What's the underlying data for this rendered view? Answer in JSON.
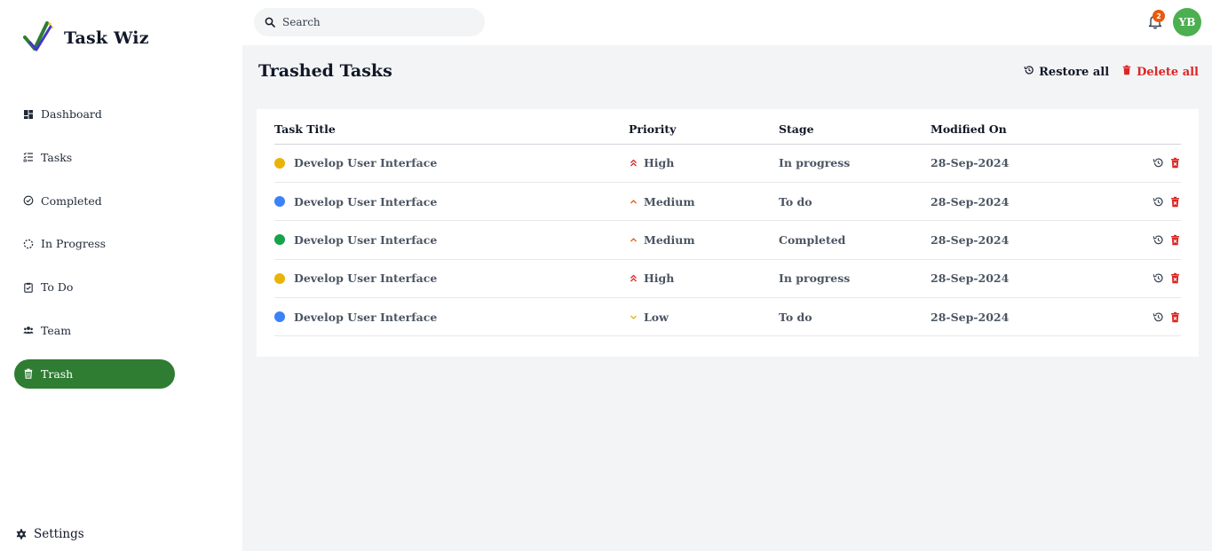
{
  "app": {
    "name": "Task Wiz"
  },
  "sidebar": {
    "items": [
      {
        "label": "Dashboard",
        "icon": "dashboard-icon"
      },
      {
        "label": "Tasks",
        "icon": "checklist-icon"
      },
      {
        "label": "Completed",
        "icon": "check-circle-icon"
      },
      {
        "label": "In Progress",
        "icon": "loader-icon"
      },
      {
        "label": "To Do",
        "icon": "clipboard-check-icon"
      },
      {
        "label": "Team",
        "icon": "users-icon"
      },
      {
        "label": "Trash",
        "icon": "trash-icon",
        "active": true
      }
    ],
    "settings_label": "Settings"
  },
  "topbar": {
    "search_placeholder": "Search",
    "notification_count": "2",
    "avatar_initials": "YB"
  },
  "main": {
    "title": "Trashed Tasks",
    "restore_all_label": "Restore all",
    "delete_all_label": "Delete all",
    "table": {
      "headers": [
        "Task Title",
        "Priority",
        "Stage",
        "Modified On"
      ],
      "rows": [
        {
          "title": "Develop User Interface",
          "dot_color": "#eab308",
          "priority": "High",
          "priority_icon": "double-chevron-up-icon",
          "stage": "In progress",
          "modified": "28-Sep-2024"
        },
        {
          "title": "Develop User Interface",
          "dot_color": "#3b82f6",
          "priority": "Medium",
          "priority_icon": "chevron-up-icon",
          "stage": "To do",
          "modified": "28-Sep-2024"
        },
        {
          "title": "Develop User Interface",
          "dot_color": "#16a34a",
          "priority": "Medium",
          "priority_icon": "chevron-up-icon",
          "stage": "Completed",
          "modified": "28-Sep-2024"
        },
        {
          "title": "Develop User Interface",
          "dot_color": "#eab308",
          "priority": "High",
          "priority_icon": "double-chevron-up-icon",
          "stage": "In progress",
          "modified": "28-Sep-2024"
        },
        {
          "title": "Develop User Interface",
          "dot_color": "#3b82f6",
          "priority": "Low",
          "priority_icon": "chevron-down-icon",
          "stage": "To do",
          "modified": "28-Sep-2024"
        }
      ]
    }
  },
  "colors": {
    "accent": "#2e7d32",
    "danger": "#dc2626",
    "priority_high": "#dc2626",
    "priority_medium": "#e8590c",
    "priority_low": "#eab308"
  }
}
